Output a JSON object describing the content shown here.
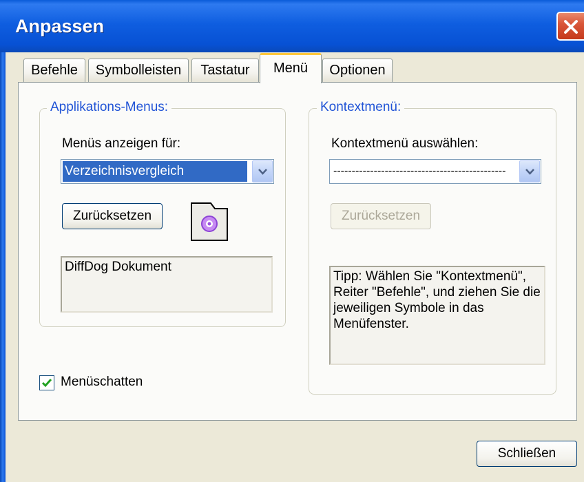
{
  "window": {
    "title": "Anpassen"
  },
  "tabs": [
    {
      "label": "Befehle",
      "active": false
    },
    {
      "label": "Symbolleisten",
      "active": false
    },
    {
      "label": "Tastatur",
      "active": false
    },
    {
      "label": "Menü",
      "active": true
    },
    {
      "label": "Optionen",
      "active": false
    }
  ],
  "app_menus": {
    "legend": "Applikations-Menus:",
    "show_for_label": "Menüs anzeigen für:",
    "show_for_value": "Verzeichnisvergleich",
    "reset_label": "Zurücksetzen",
    "document_text": "DiffDog Dokument"
  },
  "context_menu": {
    "legend": "Kontextmenü:",
    "select_label": "Kontextmenü auswählen:",
    "select_value": "-----------------------------------------------",
    "reset_label": "Zurücksetzen",
    "tip_text": "Tipp: Wählen Sie \"Kontextmenü\", Reiter \"Befehle\", und ziehen Sie die jeweiligen Symbole in das Menüfenster."
  },
  "menu_shadow": {
    "label": "Menüschatten",
    "checked": true
  },
  "footer": {
    "close_label": "Schließen"
  },
  "colors": {
    "accent": "#2154D6",
    "titlebar": "#0751D4",
    "close": "#C5391C"
  }
}
